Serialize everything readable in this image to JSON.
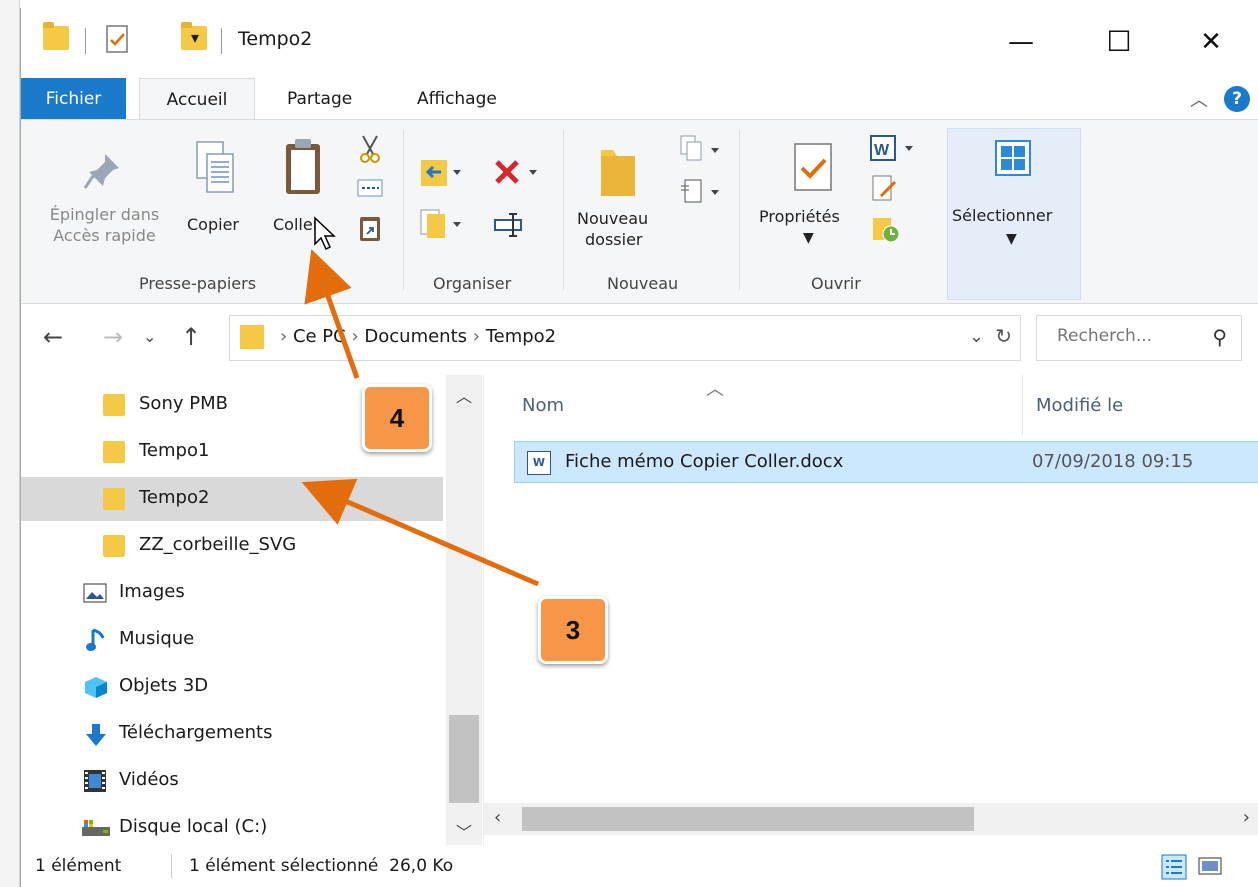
{
  "titlebar": {
    "title": "Tempo2",
    "minimize": "—",
    "maximize": "☐",
    "close": "✕"
  },
  "tabs": [
    {
      "label": "Fichier"
    },
    {
      "label": "Accueil"
    },
    {
      "label": "Partage"
    },
    {
      "label": "Affichage"
    }
  ],
  "ribbon": {
    "clipboard": {
      "pin_line1": "Épingler dans",
      "pin_line2": "Accès rapide",
      "copy": "Copier",
      "paste": "Coller",
      "group": "Presse-papiers"
    },
    "organize": {
      "group": "Organiser"
    },
    "new": {
      "folder_line1": "Nouveau",
      "folder_line2": "dossier",
      "group": "Nouveau"
    },
    "open": {
      "properties": "Propriétés",
      "group": "Ouvrir"
    },
    "select": {
      "label": "Sélectionner"
    }
  },
  "address": {
    "path": [
      "Ce PC",
      "Documents",
      "Tempo2"
    ],
    "search_placeholder": "Recherch..."
  },
  "nav_items": [
    {
      "label": "Sony PMB",
      "icon": "folder-icon"
    },
    {
      "label": "Tempo1",
      "icon": "folder-icon"
    },
    {
      "label": "Tempo2",
      "icon": "folder-icon",
      "selected": true
    },
    {
      "label": "ZZ_corbeille_SVG",
      "icon": "folder-icon"
    },
    {
      "label": "Images",
      "icon": "images-icon"
    },
    {
      "label": "Musique",
      "icon": "music-icon"
    },
    {
      "label": "Objets 3D",
      "icon": "cube-icon"
    },
    {
      "label": "Téléchargements",
      "icon": "download-icon"
    },
    {
      "label": "Vidéos",
      "icon": "video-icon"
    },
    {
      "label": "Disque local (C:)",
      "icon": "drive-icon"
    }
  ],
  "columns": {
    "name": "Nom",
    "modified": "Modifié le"
  },
  "files": [
    {
      "name": "Fiche mémo Copier Coller.docx",
      "modified": "07/09/2018 09:15",
      "selected": true
    }
  ],
  "status": {
    "count": "1 élément",
    "selection": "1 élément sélectionné  26,0 Ko"
  },
  "annotations": [
    {
      "label": "4"
    },
    {
      "label": "3"
    }
  ],
  "colors": {
    "accent": "#1979ca",
    "annotation": "#f79646",
    "arrow": "#e46c0a",
    "selection": "#cce8ff"
  }
}
